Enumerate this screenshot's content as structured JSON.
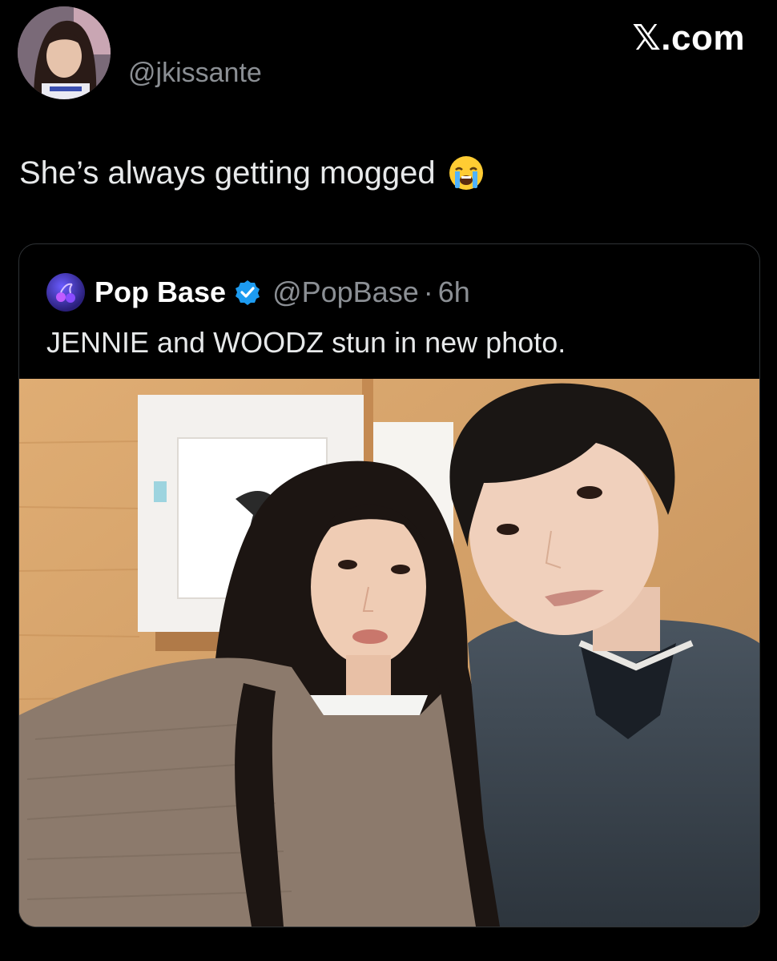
{
  "brand": {
    "label": "𝕏.com"
  },
  "author": {
    "handle": "@jkissante",
    "avatar_icon": "profile-photo"
  },
  "tweet": {
    "text": "She’s always getting mogged",
    "emoji_icon": "loudly-crying-face-emoji"
  },
  "quoted_tweet": {
    "name": "Pop Base",
    "verified_icon": "verified-badge-icon",
    "handle": "@PopBase",
    "separator": "·",
    "time": "6h",
    "text": "JENNIE and WOODZ stun in new photo.",
    "photo_icon": "selfie-photo"
  },
  "colors": {
    "background": "#000000",
    "text": "#e7e9ea",
    "secondary_text": "#8b8f94",
    "border": "#2f3336",
    "verified_blue": "#1d9bf0"
  }
}
